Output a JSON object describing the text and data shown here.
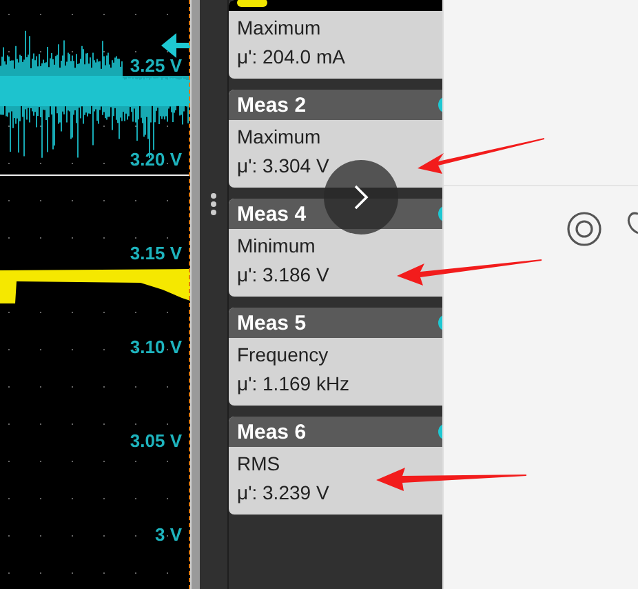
{
  "scope": {
    "scale_labels": [
      "3.25 V",
      "3.20 V",
      "3.15 V",
      "3.10 V",
      "3.05 V",
      "3 V"
    ]
  },
  "measurements": [
    {
      "color": "#f2e600",
      "statistic": "Maximum",
      "value": "μ': 204.0 mA"
    },
    {
      "title": "Meas 2",
      "color": "#1ec8d2",
      "statistic": "Maximum",
      "value": "μ': 3.304 V"
    },
    {
      "title": "Meas 4",
      "color": "#1ec8d2",
      "statistic": "Minimum",
      "value": "μ': 3.186 V"
    },
    {
      "title": "Meas 5",
      "color": "#1ec8d2",
      "statistic": "Frequency",
      "value": "μ': 1.169 kHz"
    },
    {
      "title": "Meas 6",
      "color": "#1ec8d2",
      "statistic": "RMS",
      "value": "μ': 3.239 V"
    }
  ]
}
